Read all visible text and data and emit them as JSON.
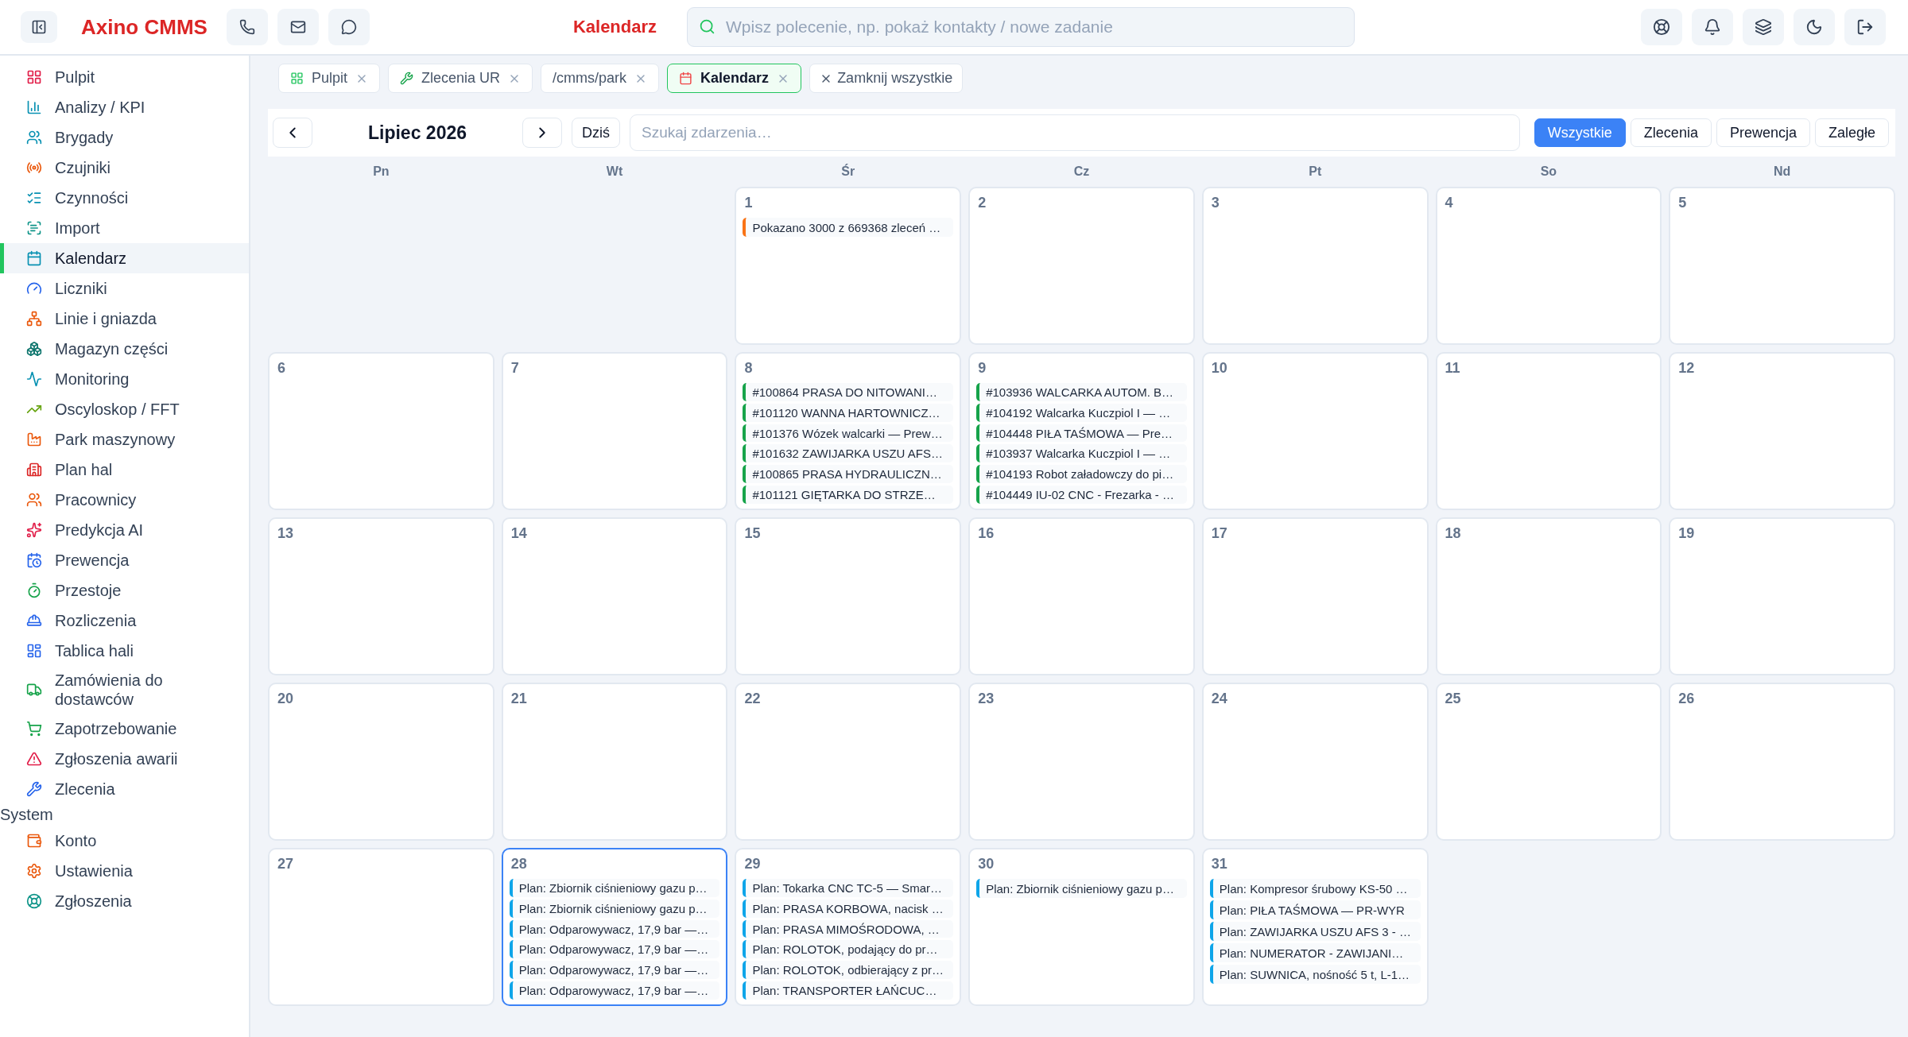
{
  "header": {
    "brand": "Axino CMMS",
    "page_title": "Kalendarz",
    "search": {
      "placeholder": "Wpisz polecenie, np. pokaż kontakty / nowe zadanie"
    }
  },
  "sidebar": {
    "items": [
      {
        "label": "Pulpit",
        "selected": false
      },
      {
        "label": "Analizy / KPI",
        "selected": false
      },
      {
        "label": "Brygady",
        "selected": false
      },
      {
        "label": "Czujniki",
        "selected": false
      },
      {
        "label": "Czynności",
        "selected": false
      },
      {
        "label": "Import",
        "selected": false
      },
      {
        "label": "Kalendarz",
        "selected": true
      },
      {
        "label": "Liczniki",
        "selected": false
      },
      {
        "label": "Linie i gniazda",
        "selected": false
      },
      {
        "label": "Magazyn części",
        "selected": false
      },
      {
        "label": "Monitoring",
        "selected": false
      },
      {
        "label": "Oscyloskop / FFT",
        "selected": false
      },
      {
        "label": "Park maszynowy",
        "selected": false
      },
      {
        "label": "Plan hal",
        "selected": false
      },
      {
        "label": "Pracownicy",
        "selected": false
      },
      {
        "label": "Predykcja AI",
        "selected": false
      },
      {
        "label": "Prewencja",
        "selected": false
      },
      {
        "label": "Przestoje",
        "selected": false
      },
      {
        "label": "Rozliczenia",
        "selected": false
      },
      {
        "label": "Tablica hali",
        "selected": false
      },
      {
        "label": "Zamówienia do dostawców",
        "selected": false
      },
      {
        "label": "Zapotrzebowanie",
        "selected": false
      },
      {
        "label": "Zgłoszenia awarii",
        "selected": false
      },
      {
        "label": "Zlecenia",
        "selected": false
      }
    ],
    "section": "System",
    "system_items": [
      {
        "label": "Konto",
        "selected": false
      },
      {
        "label": "Ustawienia",
        "selected": false
      },
      {
        "label": "Zgłoszenia",
        "selected": false
      }
    ]
  },
  "tabs": [
    {
      "label": "Pulpit",
      "selected": false
    },
    {
      "label": "Zlecenia UR",
      "selected": false
    },
    {
      "label": "/cmms/park",
      "selected": false
    },
    {
      "label": "Kalendarz",
      "selected": true
    }
  ],
  "close_all": "Zamknij wszystkie",
  "calendar": {
    "month": "Lipiec 2026",
    "today": "Dziś",
    "search": {
      "placeholder": "Szukaj zdarzenia…"
    },
    "filters": [
      {
        "label": "Wszystkie",
        "selected": true
      },
      {
        "label": "Zlecenia",
        "selected": false
      },
      {
        "label": "Prewencja",
        "selected": false
      },
      {
        "label": "Zaległe",
        "selected": false
      }
    ],
    "weekdays": [
      "Pn",
      "Wt",
      "Śr",
      "Cz",
      "Pt",
      "So",
      "Nd"
    ],
    "days": [
      {
        "day": "1",
        "selected": false,
        "events": [
          {
            "text": "Pokazano 3000 z 669368 zleceń …",
            "color": "#f97316"
          }
        ]
      },
      {
        "day": "2",
        "selected": false
      },
      {
        "day": "3",
        "selected": false
      },
      {
        "day": "4",
        "selected": false
      },
      {
        "day": "5",
        "selected": false
      },
      {
        "day": "6",
        "selected": false
      },
      {
        "day": "7",
        "selected": false
      },
      {
        "day": "8",
        "selected": false,
        "events": [
          {
            "text": "#100864 PRASA DO NITOWANI…",
            "color": "#16a34a"
          },
          {
            "text": "#101120 WANNA HARTOWNICZ…",
            "color": "#16a34a"
          },
          {
            "text": "#101376 Wózek walcarki — Prew…",
            "color": "#16a34a"
          },
          {
            "text": "#101632 ZAWIJARKA USZU AFS…",
            "color": "#16a34a"
          },
          {
            "text": "#100865 PRASA HYDRAULICZN…",
            "color": "#16a34a"
          },
          {
            "text": "#101121 GIĘTARKA DO STRZE…",
            "color": "#16a34a"
          }
        ]
      },
      {
        "day": "9",
        "selected": false,
        "events": [
          {
            "text": "#103936 WALCARKA AUTOM. B…",
            "color": "#16a34a"
          },
          {
            "text": "#104192 Walcarka Kuczpiol I — …",
            "color": "#16a34a"
          },
          {
            "text": "#104448 PIŁA TAŚMOWA — Pre…",
            "color": "#16a34a"
          },
          {
            "text": "#103937 Walcarka Kuczpiol I — …",
            "color": "#16a34a"
          },
          {
            "text": "#104193 Robot załadowczy do pi…",
            "color": "#16a34a"
          },
          {
            "text": "#104449 IU-02 CNC - Frezarka - …",
            "color": "#16a34a"
          }
        ]
      },
      {
        "day": "10",
        "selected": false
      },
      {
        "day": "11",
        "selected": false
      },
      {
        "day": "12",
        "selected": false
      },
      {
        "day": "13",
        "selected": false
      },
      {
        "day": "14",
        "selected": false
      },
      {
        "day": "15",
        "selected": false
      },
      {
        "day": "16",
        "selected": false
      },
      {
        "day": "17",
        "selected": false
      },
      {
        "day": "18",
        "selected": false
      },
      {
        "day": "19",
        "selected": false
      },
      {
        "day": "20",
        "selected": false
      },
      {
        "day": "21",
        "selected": false
      },
      {
        "day": "22",
        "selected": false
      },
      {
        "day": "23",
        "selected": false
      },
      {
        "day": "24",
        "selected": false
      },
      {
        "day": "25",
        "selected": false
      },
      {
        "day": "26",
        "selected": false
      },
      {
        "day": "27",
        "selected": false
      },
      {
        "day": "28",
        "selected": true,
        "events": [
          {
            "text": "Plan: Zbiornik ciśnieniowy gazu p…",
            "color": "#0ea5e9"
          },
          {
            "text": "Plan: Zbiornik ciśnieniowy gazu p…",
            "color": "#0ea5e9"
          },
          {
            "text": "Plan: Odparowywacz, 17,9 bar —…",
            "color": "#0ea5e9"
          },
          {
            "text": "Plan: Odparowywacz, 17,9 bar —…",
            "color": "#0ea5e9"
          },
          {
            "text": "Plan: Odparowywacz, 17,9 bar —…",
            "color": "#0ea5e9"
          },
          {
            "text": "Plan: Odparowywacz, 17,9 bar —…",
            "color": "#0ea5e9"
          }
        ]
      },
      {
        "day": "29",
        "selected": false,
        "events": [
          {
            "text": "Plan: Tokarka CNC TC-5 — Smar…",
            "color": "#0ea5e9"
          },
          {
            "text": "Plan: PRASA KORBOWA, nacisk …",
            "color": "#0ea5e9"
          },
          {
            "text": "Plan: PRASA MIMOŚRODOWA, …",
            "color": "#0ea5e9"
          },
          {
            "text": "Plan: ROLOTOK, podający do pr…",
            "color": "#0ea5e9"
          },
          {
            "text": "Plan: ROLOTOK, odbierający z pr…",
            "color": "#0ea5e9"
          },
          {
            "text": "Plan: TRANSPORTER ŁAŃCUC…",
            "color": "#0ea5e9"
          }
        ]
      },
      {
        "day": "30",
        "selected": false,
        "events": [
          {
            "text": "Plan: Zbiornik ciśnieniowy gazu p…",
            "color": "#0ea5e9"
          }
        ]
      },
      {
        "day": "31",
        "selected": false,
        "events": [
          {
            "text": "Plan: Kompresor śrubowy KS-50 …",
            "color": "#0ea5e9"
          },
          {
            "text": "Plan: PIŁA TAŚMOWA — PR-WYR",
            "color": "#0ea5e9"
          },
          {
            "text": "Plan: ZAWIJARKA USZU AFS 3 - …",
            "color": "#0ea5e9"
          },
          {
            "text": "Plan: NUMERATOR - ZAWIJANI…",
            "color": "#0ea5e9"
          },
          {
            "text": "Plan: SUWNICA, nośność 5 t, L-1…",
            "color": "#0ea5e9"
          }
        ]
      }
    ]
  }
}
